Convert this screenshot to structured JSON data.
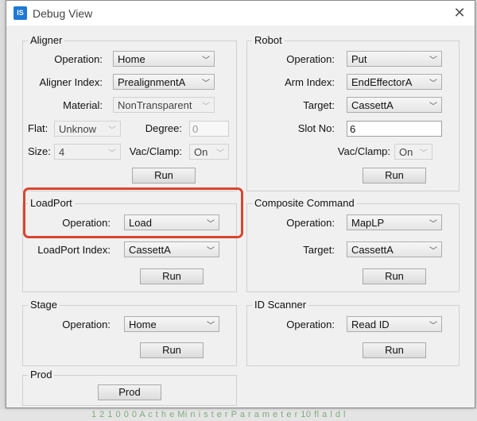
{
  "window": {
    "title": "Debug View",
    "icon_text": "IS",
    "close_icon": "close-icon"
  },
  "aligner": {
    "group_title": "Aligner",
    "operation_label": "Operation:",
    "operation_value": "Home",
    "index_label": "Aligner Index:",
    "index_value": "PrealignmentA",
    "material_label": "Material:",
    "material_value": "NonTransparent",
    "flat_label": "Flat:",
    "flat_value": "Unknow",
    "degree_label": "Degree:",
    "degree_value": "0",
    "size_label": "Size:",
    "size_value": "4",
    "vac_label": "Vac/Clamp:",
    "vac_value": "On",
    "run_label": "Run"
  },
  "robot": {
    "group_title": "Robot",
    "operation_label": "Operation:",
    "operation_value": "Put",
    "arm_label": "Arm Index:",
    "arm_value": "EndEffectorA",
    "target_label": "Target:",
    "target_value": "CassettA",
    "slot_label": "Slot No:",
    "slot_value": "6",
    "vac_label": "Vac/Clamp:",
    "vac_value": "On",
    "run_label": "Run"
  },
  "loadport": {
    "group_title": "LoadPort",
    "operation_label": "Operation:",
    "operation_value": "Load",
    "index_label": "LoadPort Index:",
    "index_value": "CassettA",
    "run_label": "Run"
  },
  "composite": {
    "group_title": "Composite Command",
    "operation_label": "Operation:",
    "operation_value": "MapLP",
    "target_label": "Target:",
    "target_value": "CassettA",
    "run_label": "Run"
  },
  "stage": {
    "group_title": "Stage",
    "operation_label": "Operation:",
    "operation_value": "Home",
    "run_label": "Run"
  },
  "idscanner": {
    "group_title": "ID Scanner",
    "operation_label": "Operation:",
    "operation_value": "Read ID",
    "run_label": "Run"
  },
  "prod": {
    "group_title": "Prod",
    "button_label": "Prod"
  },
  "background": {
    "status_text": "1 2 1 0 0 0   A c t h e  Mi n i s t e r  P a r a m e t e r  10  fl a l d l"
  },
  "colors": {
    "highlight": "#d9452f",
    "app_icon": "#1e78d7"
  }
}
